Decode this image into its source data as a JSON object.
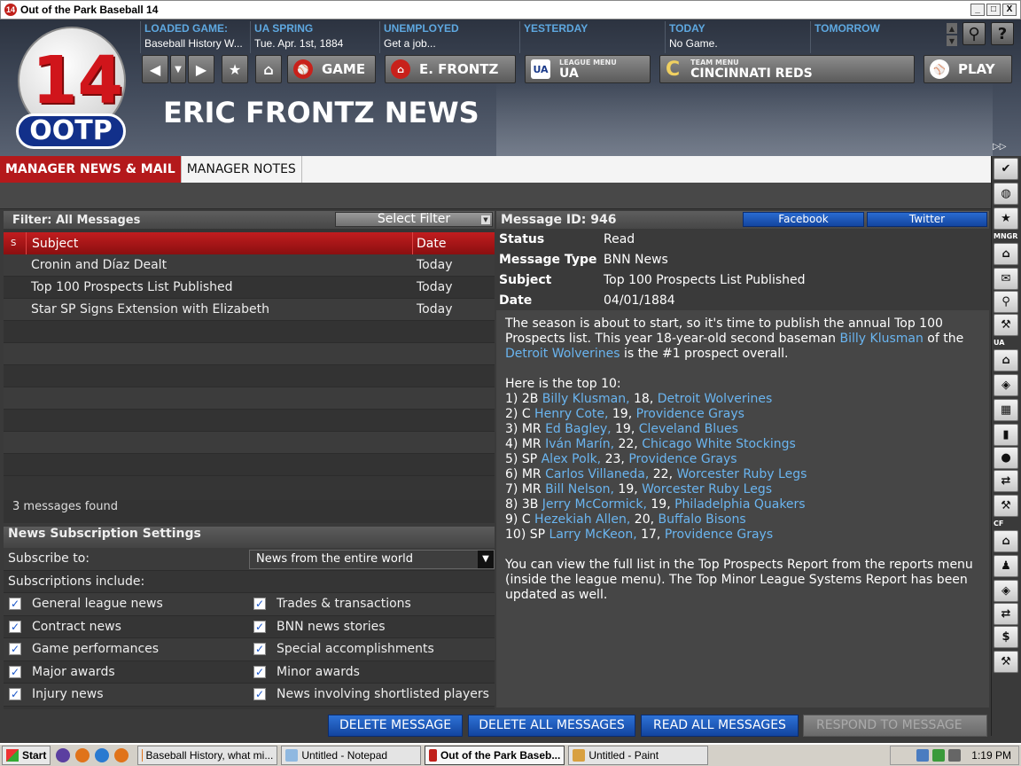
{
  "window": {
    "title": "Out of the Park Baseball 14",
    "app_icon_text": "14",
    "min": "_",
    "max": "□",
    "close": "X"
  },
  "logo": {
    "number": "14",
    "text": "OOTP"
  },
  "info": [
    {
      "label": "LOADED GAME:",
      "value": "Baseball History W..."
    },
    {
      "label": "UA SPRING",
      "value": "Tue. Apr. 1st, 1884"
    },
    {
      "label": "UNEMPLOYED",
      "value": "Get a job..."
    },
    {
      "label": "YESTERDAY",
      "value": ""
    },
    {
      "label": "TODAY",
      "value": "No Game."
    },
    {
      "label": "TOMORROW",
      "value": ""
    }
  ],
  "nav": {
    "back": "◀",
    "dropdown": "▼",
    "forward": "▶",
    "favorite": "★",
    "home": "⌂",
    "game": "GAME",
    "manager": "E. FRONTZ",
    "league_small": "LEAGUE MENU",
    "league": "UA",
    "team_small": "TEAM MENU",
    "team_letter": "C",
    "team": "CINCINNATI REDS",
    "play": "PLAY",
    "search": "⚲",
    "help": "?"
  },
  "page_title": "ERIC FRONTZ NEWS",
  "tabs": [
    "MANAGER NEWS & MAIL",
    "MANAGER NOTES"
  ],
  "filter": {
    "label": "Filter: All Messages",
    "button": "Select Filter",
    "dd": "▼"
  },
  "list": {
    "columns": {
      "s": "S",
      "subject": "Subject",
      "date": "Date"
    },
    "rows": [
      {
        "subject": "Cronin and Díaz Dealt",
        "date": "Today"
      },
      {
        "subject": "Top 100 Prospects List Published",
        "date": "Today"
      },
      {
        "subject": "Star SP Signs Extension with Elizabeth",
        "date": "Today"
      }
    ],
    "count": "3 messages found"
  },
  "subscriptions": {
    "title": "News Subscription Settings",
    "subscribe_label": "Subscribe to:",
    "subscribe_value": "News from the entire world",
    "include_label": "Subscriptions include:",
    "check": "✓",
    "left": [
      "General league news",
      "Contract news",
      "Game performances",
      "Major awards",
      "Injury news"
    ],
    "right": [
      "Trades & transactions",
      "BNN news stories",
      "Special accomplishments",
      "Minor awards",
      "News involving shortlisted players"
    ]
  },
  "message": {
    "id_label": "Message ID: 946",
    "facebook": "Facebook",
    "twitter": "Twitter",
    "meta": [
      {
        "key": "Status",
        "value": "Read"
      },
      {
        "key": "Message Type",
        "value": "BNN News"
      },
      {
        "key": "Subject",
        "value": "Top 100 Prospects List Published"
      },
      {
        "key": "Date",
        "value": "04/01/1884"
      }
    ],
    "intro_1": "The season is about to start, so it's time to publish the annual Top 100 Prospects list. This year 18-year-old second baseman ",
    "intro_player": "Billy Klusman",
    "intro_2": " of the ",
    "intro_team": "Detroit Wolverines",
    "intro_3": " is the #1 prospect overall.",
    "top_heading": "Here is the top 10:",
    "top10": [
      {
        "pre": "1) 2B ",
        "player": "Billy Klusman,",
        "age": " 18, ",
        "team": "Detroit Wolverines"
      },
      {
        "pre": "2) C ",
        "player": "Henry Cote,",
        "age": " 19, ",
        "team": "Providence Grays"
      },
      {
        "pre": "3) MR ",
        "player": "Ed Bagley,",
        "age": " 19, ",
        "team": "Cleveland Blues"
      },
      {
        "pre": "4) MR ",
        "player": "Iván Marín,",
        "age": " 22, ",
        "team": "Chicago White Stockings"
      },
      {
        "pre": "5) SP ",
        "player": "Alex Polk,",
        "age": " 23, ",
        "team": "Providence Grays"
      },
      {
        "pre": "6) MR ",
        "player": "Carlos Villaneda,",
        "age": " 22, ",
        "team": "Worcester Ruby Legs"
      },
      {
        "pre": "7) MR ",
        "player": "Bill Nelson,",
        "age": " 19, ",
        "team": "Worcester Ruby Legs"
      },
      {
        "pre": "8) 3B ",
        "player": "Jerry McCormick,",
        "age": " 19, ",
        "team": "Philadelphia Quakers"
      },
      {
        "pre": "9) C ",
        "player": "Hezekiah Allen,",
        "age": " 20, ",
        "team": "Buffalo Bisons"
      },
      {
        "pre": "10) SP ",
        "player": "Larry McKeon,",
        "age": " 17, ",
        "team": "Providence Grays"
      }
    ],
    "closing": "You can view the full list in the Top Prospects Report from the reports menu (inside the league menu). The Top Minor League Systems Report has been updated as well."
  },
  "actions": {
    "delete": "DELETE MESSAGE",
    "delete_all": "DELETE ALL MESSAGES",
    "read_all": "READ ALL MESSAGES",
    "respond": "RESPOND TO MESSAGE"
  },
  "sidebar": {
    "label_mngr": "MNGR",
    "label_ua": "UA",
    "label_cf": "CF",
    "toggle": "▷▷"
  },
  "taskbar": {
    "start": "Start",
    "items": [
      "Baseball History, what mi...",
      "Untitled - Notepad",
      "Out of the Park Baseb...",
      "Untitled - Paint"
    ],
    "clock": "1:19 PM"
  }
}
